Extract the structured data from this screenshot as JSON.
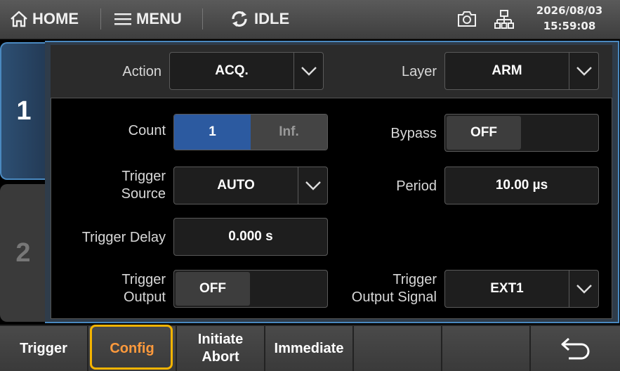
{
  "topbar": {
    "home_label": "HOME",
    "menu_label": "MENU",
    "status_label": "IDLE",
    "date": "2026/08/03",
    "time": "15:59:08"
  },
  "tabs": [
    {
      "label": "1",
      "active": true
    },
    {
      "label": "2",
      "active": false
    }
  ],
  "form": {
    "action": {
      "label": "Action",
      "value": "ACQ."
    },
    "layer": {
      "label": "Layer",
      "value": "ARM"
    },
    "count": {
      "label": "Count",
      "options": [
        "1",
        "Inf."
      ],
      "selected": "1"
    },
    "bypass": {
      "label": "Bypass",
      "value": "OFF"
    },
    "trigger_source": {
      "label_line1": "Trigger",
      "label_line2": "Source",
      "value": "AUTO"
    },
    "period": {
      "label": "Period",
      "value": "10.00 µs"
    },
    "trigger_delay": {
      "label": "Trigger Delay",
      "value": "0.000 s"
    },
    "trigger_output": {
      "label_line1": "Trigger",
      "label_line2": "Output",
      "value": "OFF"
    },
    "trigger_output_signal": {
      "label_line1": "Trigger",
      "label_line2": "Output Signal",
      "value": "EXT1"
    }
  },
  "softkeys": {
    "trigger": "Trigger",
    "config": "Config",
    "initiate_line1": "Initiate",
    "initiate_line2": "Abort",
    "immediate": "Immediate",
    "selected": "Config"
  },
  "colors": {
    "accent_blue": "#2c5aa0",
    "selected_text": "#ff9a3c",
    "selected_ring": "#f5b400",
    "panel_border": "#4a89c0"
  },
  "icons": [
    "home-icon",
    "menu-icon",
    "idle-refresh-icon",
    "camera-icon",
    "network-icon",
    "chevron-down-icon",
    "back-arrow-icon"
  ]
}
